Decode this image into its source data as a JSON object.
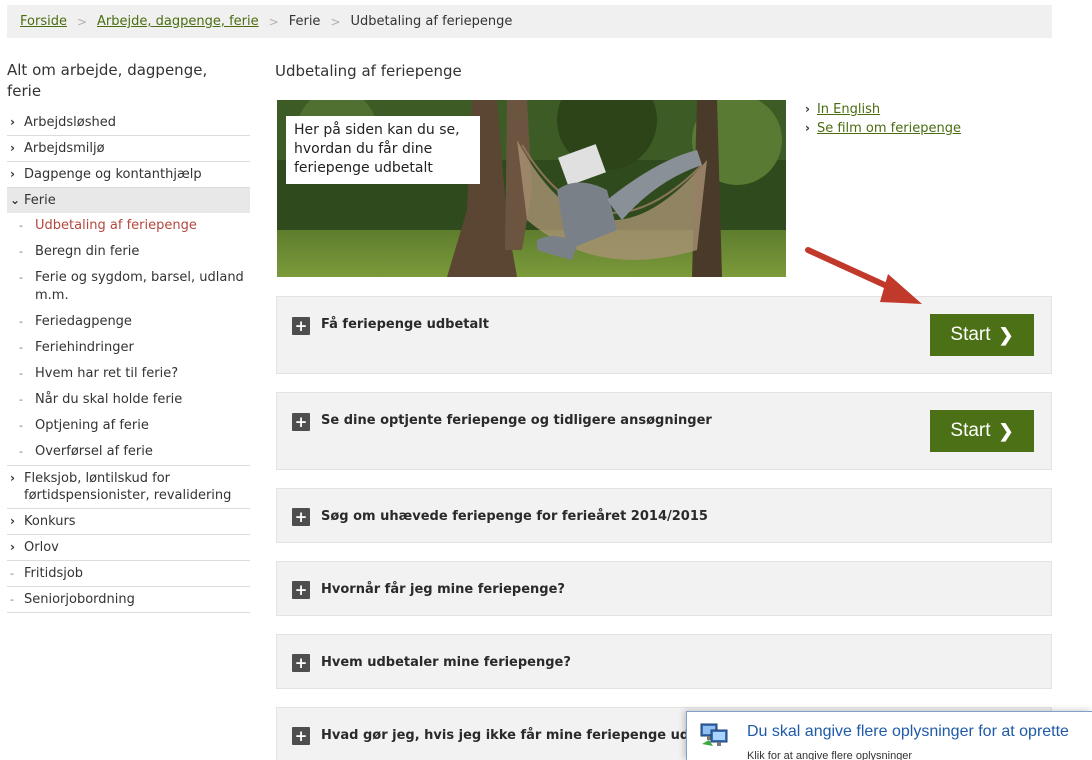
{
  "breadcrumb": {
    "items": [
      "Forside",
      "Arbejde, dagpenge, ferie",
      "Ferie",
      "Udbetaling af feriepenge"
    ],
    "separator": ">"
  },
  "sidebar": {
    "title": "Alt om arbejde, dagpenge, ferie",
    "items": [
      "Arbejdsløshed",
      "Arbejdsmiljø",
      "Dagpenge og kontanthjælp",
      "Ferie",
      "Fleksjob, løntilskud for førtidspensionister, revalidering",
      "Konkurs",
      "Orlov",
      "Fritidsjob",
      "Seniorjobordning"
    ],
    "ferie_subitems": [
      "Udbetaling af feriepenge",
      "Beregn din ferie",
      "Ferie og sygdom, barsel, udland m.m.",
      "Feriedagpenge",
      "Feriehindringer",
      "Hvem har ret til ferie?",
      "Når du skal holde ferie",
      "Optjening af ferie",
      "Overførsel af ferie"
    ]
  },
  "main": {
    "title": "Udbetaling af feriepenge",
    "hero_caption": "Her på siden kan du se, hvordan du får dine feriepenge udbetalt",
    "links": [
      "In English",
      "Se film om feriepenge"
    ],
    "accordions": [
      "Få feriepenge udbetalt",
      "Se dine optjente feriepenge og tidligere ansøgninger",
      "Søg om uhævede feriepenge for ferieåret 2014/2015",
      "Hvornår får jeg mine feriepenge?",
      "Hvem udbetaler mine feriepenge?",
      "Hvad gør jeg, hvis jeg ikke får mine feriepenge udbetalt?"
    ],
    "start_label": "Start",
    "plus_symbol": "+"
  },
  "notification": {
    "title": "Du skal angive flere oplysninger for at oprette",
    "subtitle": "Klik for at angive flere oplysninger"
  },
  "colors": {
    "link_green": "#4a6d10",
    "button_green": "#4b7015",
    "active_red": "#b4473e",
    "arrow_red": "#c0392b"
  }
}
